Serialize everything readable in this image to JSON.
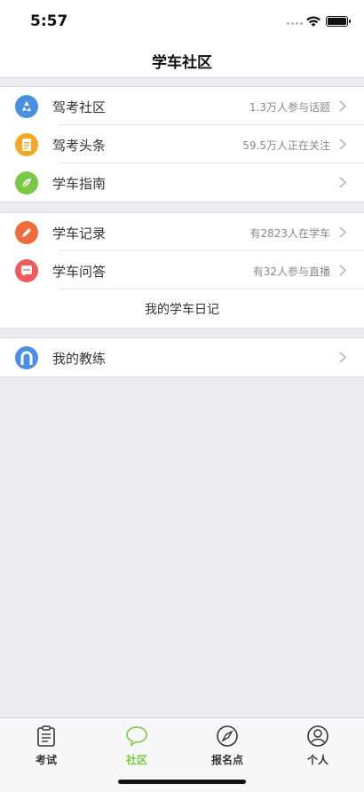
{
  "status": {
    "time": "5:57"
  },
  "nav": {
    "title": "学车社区"
  },
  "group1": [
    {
      "label": "驾考社区",
      "detail": "1.3万人参与话题",
      "color": "#4a90e2",
      "icon": "recycle-icon"
    },
    {
      "label": "驾考头条",
      "detail": "59.5万人正在关注",
      "color": "#f5a623",
      "icon": "document-icon"
    },
    {
      "label": "学车指南",
      "detail": "",
      "color": "#7ac943",
      "icon": "leaf-icon"
    }
  ],
  "group2": [
    {
      "label": "学车记录",
      "detail": "有2823人在学车",
      "color": "#f26b3a",
      "icon": "pencil-icon"
    },
    {
      "label": "学车问答",
      "detail": "有32人参与直播",
      "color": "#ef5a5a",
      "icon": "chat-bubble-icon"
    }
  ],
  "diary": {
    "label": "我的学车日记"
  },
  "group3": [
    {
      "label": "我的教练",
      "color": "#4a90e2",
      "icon": "user-icon"
    }
  ],
  "tabs": [
    {
      "label": "考试",
      "icon": "clipboard-icon"
    },
    {
      "label": "社区",
      "icon": "chat-icon"
    },
    {
      "label": "报名点",
      "icon": "compass-icon"
    },
    {
      "label": "个人",
      "icon": "person-icon"
    }
  ],
  "colors": {
    "accent": "#7ac943"
  }
}
